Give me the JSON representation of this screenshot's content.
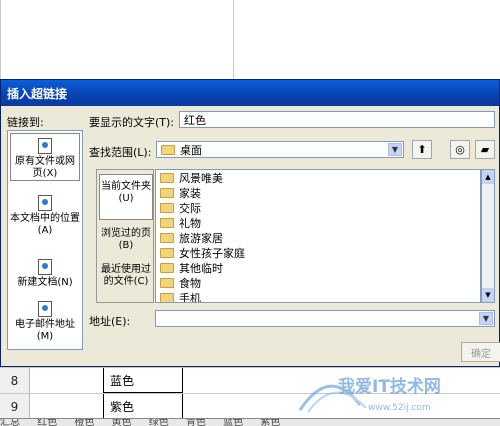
{
  "dialog": {
    "title": "插入超链接",
    "link_to_label": "链接到:",
    "left_nav": [
      {
        "label": "原有文件或网页(X)",
        "icon": "web-page-icon"
      },
      {
        "label": "本文档中的位置(A)",
        "icon": "document-place-icon"
      },
      {
        "label": "新建文档(N)",
        "icon": "new-document-icon"
      },
      {
        "label": "电子邮件地址(M)",
        "icon": "email-icon"
      }
    ],
    "display_text_label": "要显示的文字(T):",
    "display_text_value": "红色",
    "look_in_label": "查找范围(L):",
    "look_in_value": "桌面",
    "mid_nav": [
      {
        "label": "当前文件夹(U)"
      },
      {
        "label": "浏览过的页(B)"
      },
      {
        "label": "最近使用过的文件(C)"
      }
    ],
    "files": [
      "风景唯美",
      "家装",
      "交际",
      "礼物",
      "旅游家居",
      "女性孩子家庭",
      "其他临时",
      "食物",
      "手机"
    ],
    "address_label": "地址(E):",
    "address_value": "",
    "ok_label": "确定"
  },
  "sheet": {
    "rows": [
      {
        "num": "8",
        "value": "蓝色"
      },
      {
        "num": "9",
        "value": "紫色"
      }
    ],
    "tabs": [
      "汇总",
      "红色",
      "橙色",
      "黄色",
      "绿色",
      "青色",
      "蓝色",
      "紫色"
    ]
  },
  "watermark": {
    "text": "我爱IT技术网",
    "url": "www.52ij.com"
  }
}
